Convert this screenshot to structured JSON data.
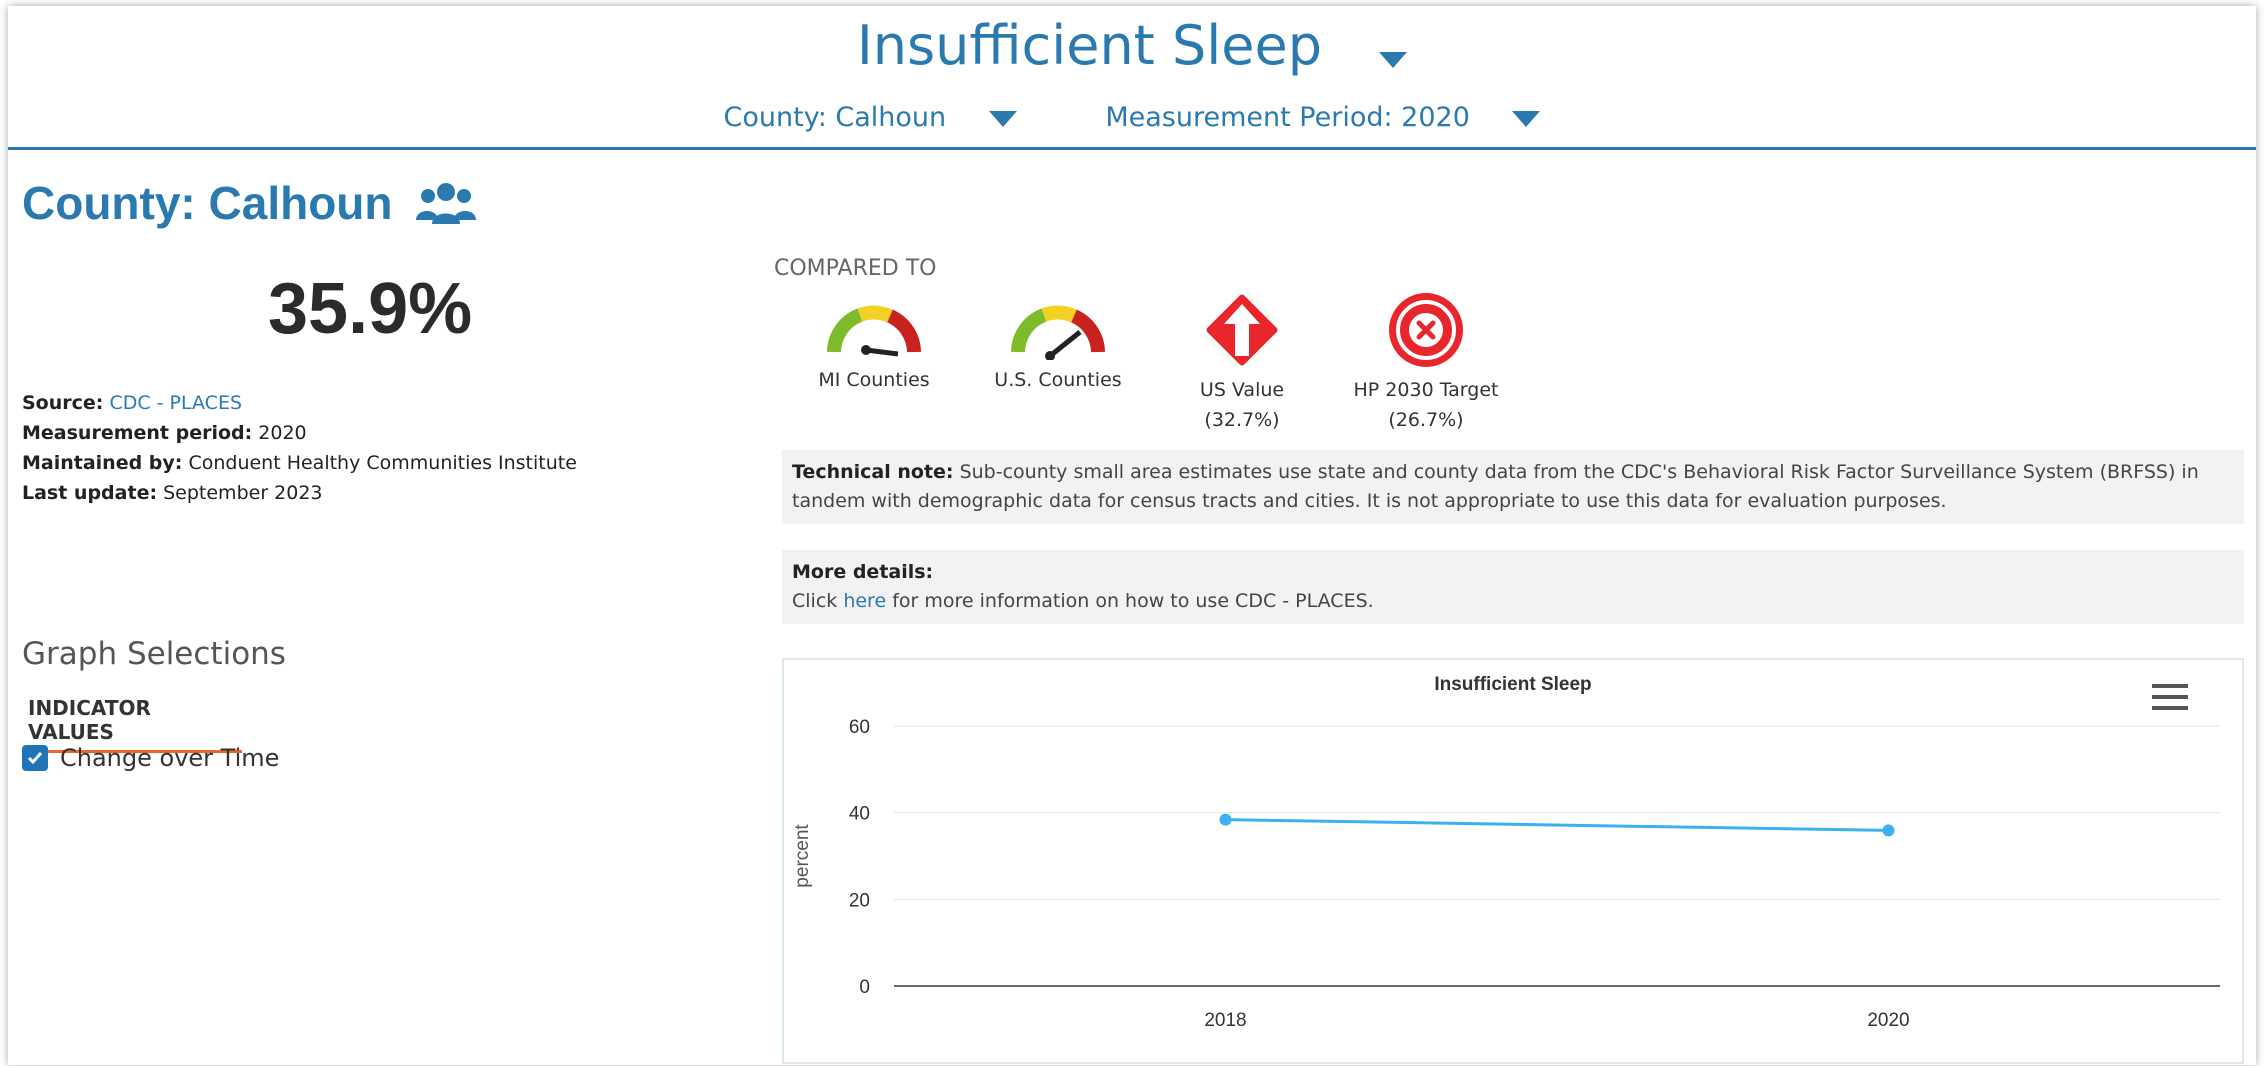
{
  "header": {
    "title": "Insufficient Sleep",
    "location_filter": "County: Calhoun",
    "period_filter": "Measurement Period: 2020"
  },
  "colors": {
    "accent": "#2a7ab0",
    "tab_underline": "#e8692b",
    "series_line": "#3ab0f0",
    "alert_red": "#e8262b"
  },
  "left": {
    "location_title": "County: Calhoun",
    "location_icon": "people-group-icon",
    "value": "35.9%",
    "meta": {
      "source_label": "Source:",
      "source_value": "CDC - PLACES",
      "period_label": "Measurement period:",
      "period_value": "2020",
      "maintained_label": "Maintained by:",
      "maintained_value": "Conduent Healthy Communities Institute",
      "update_label": "Last update:",
      "update_value": "September 2023"
    },
    "graph_selections": "Graph Selections",
    "indicator_tab": "INDICATOR VALUES",
    "checkbox_label": "Change over Time",
    "checkbox_checked": true
  },
  "compared": {
    "heading": "COMPARED TO",
    "items": [
      {
        "label": "MI Counties",
        "value": "",
        "icon": "gauge-icon"
      },
      {
        "label": "U.S. Counties",
        "value": "",
        "icon": "gauge-icon"
      },
      {
        "label": "US Value",
        "value": "(32.7%)",
        "icon": "up-arrow-alert-icon"
      },
      {
        "label": "HP 2030 Target",
        "value": "(26.7%)",
        "icon": "x-circle-icon"
      }
    ]
  },
  "technical_note": {
    "label": "Technical note:",
    "text": "Sub-county small area estimates use state and county data from the CDC's Behavioral Risk Factor Surveillance System (BRFSS) in tandem with demographic data for census tracts and cities. It is not appropriate to use this data for evaluation purposes."
  },
  "more_details": {
    "label": "More details:",
    "pre": "Click",
    "link": "here",
    "post": "for more information on how to use CDC - PLACES."
  },
  "chart_data": {
    "type": "line",
    "title": "Insufficient Sleep",
    "xlabel": "",
    "ylabel": "percent",
    "categories": [
      "2018",
      "2020"
    ],
    "series": [
      {
        "values": [
          38.4,
          35.9
        ]
      }
    ],
    "ylim": [
      0,
      60
    ],
    "yticks": [
      0,
      20,
      40,
      60
    ],
    "grid": true,
    "legend": "none"
  }
}
